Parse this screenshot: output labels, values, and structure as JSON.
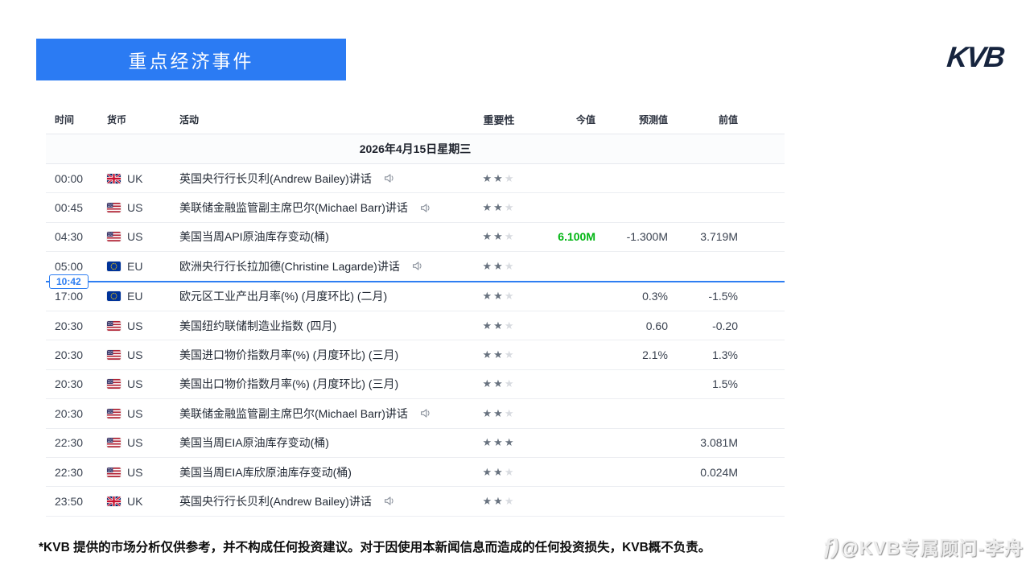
{
  "banner": {
    "title": "重点经济事件"
  },
  "logo": {
    "text": "KVB"
  },
  "table": {
    "headers": {
      "time": "时间",
      "currency": "货币",
      "activity": "活动",
      "importance": "重要性",
      "actual": "今值",
      "forecast": "预测值",
      "previous": "前值"
    },
    "date_header": "2026年4月15日星期三",
    "time_marker": {
      "label": "10:42",
      "after_row_index": 3
    },
    "rows": [
      {
        "time": "00:00",
        "country": "UK",
        "flag": "uk",
        "activity": "英国央行行长贝利(Andrew Bailey)讲话",
        "speech": true,
        "importance": 2,
        "actual": "",
        "forecast": "",
        "previous": ""
      },
      {
        "time": "00:45",
        "country": "US",
        "flag": "us",
        "activity": "美联储金融监管副主席巴尔(Michael Barr)讲话",
        "speech": true,
        "importance": 2,
        "actual": "",
        "forecast": "",
        "previous": ""
      },
      {
        "time": "04:30",
        "country": "US",
        "flag": "us",
        "activity": "美国当周API原油库存变动(桶)",
        "speech": false,
        "importance": 2,
        "actual": "6.100M",
        "actual_positive": true,
        "forecast": "-1.300M",
        "previous": "3.719M"
      },
      {
        "time": "05:00",
        "country": "EU",
        "flag": "eu",
        "activity": "欧洲央行行长拉加德(Christine Lagarde)讲话",
        "speech": true,
        "importance": 2,
        "actual": "",
        "forecast": "",
        "previous": ""
      },
      {
        "time": "17:00",
        "country": "EU",
        "flag": "eu",
        "activity": "欧元区工业产出月率(%) (月度环比) (二月)",
        "speech": false,
        "importance": 2,
        "actual": "",
        "forecast": "0.3%",
        "previous": "-1.5%"
      },
      {
        "time": "20:30",
        "country": "US",
        "flag": "us",
        "activity": "美国纽约联储制造业指数 (四月)",
        "speech": false,
        "importance": 2,
        "actual": "",
        "forecast": "0.60",
        "previous": "-0.20"
      },
      {
        "time": "20:30",
        "country": "US",
        "flag": "us",
        "activity": "美国进口物价指数月率(%) (月度环比) (三月)",
        "speech": false,
        "importance": 2,
        "actual": "",
        "forecast": "2.1%",
        "previous": "1.3%"
      },
      {
        "time": "20:30",
        "country": "US",
        "flag": "us",
        "activity": "美国出口物价指数月率(%) (月度环比) (三月)",
        "speech": false,
        "importance": 2,
        "actual": "",
        "forecast": "",
        "previous": "1.5%"
      },
      {
        "time": "20:30",
        "country": "US",
        "flag": "us",
        "activity": "美联储金融监管副主席巴尔(Michael Barr)讲话",
        "speech": true,
        "importance": 2,
        "actual": "",
        "forecast": "",
        "previous": ""
      },
      {
        "time": "22:30",
        "country": "US",
        "flag": "us",
        "activity": "美国当周EIA原油库存变动(桶)",
        "speech": false,
        "importance": 3,
        "actual": "",
        "forecast": "",
        "previous": "3.081M"
      },
      {
        "time": "22:30",
        "country": "US",
        "flag": "us",
        "activity": "美国当周EIA库欣原油库存变动(桶)",
        "speech": false,
        "importance": 2,
        "actual": "",
        "forecast": "",
        "previous": "0.024M"
      },
      {
        "time": "23:50",
        "country": "UK",
        "flag": "uk",
        "activity": "英国央行行长贝利(Andrew Bailey)讲话",
        "speech": true,
        "importance": 2,
        "actual": "",
        "forecast": "",
        "previous": ""
      }
    ]
  },
  "footer": {
    "disclaimer": "*KVB 提供的市场分析仅供参考，并不构成任何投资建议。对于因使用本新闻信息而造成的任何投资损失，KVB概不负责。",
    "watermark": "@KVB专属顾问-李舟",
    "watermark_icon": "ƒ)"
  },
  "colors": {
    "accent_blue": "#2b7bf3",
    "marker_blue": "#2e7ef2",
    "positive_green": "#00b512",
    "star_filled": "#68727f",
    "star_empty": "#d8dbe0",
    "logo_navy": "#16243e"
  }
}
